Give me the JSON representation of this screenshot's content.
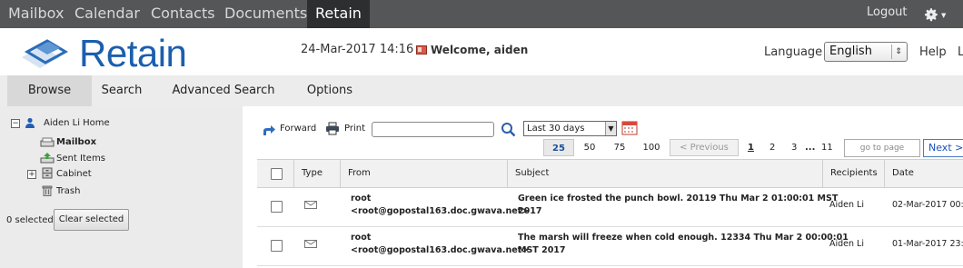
{
  "topbar": {
    "apps": [
      "Mailbox",
      "Calendar",
      "Contacts",
      "Documents",
      "Retain"
    ],
    "active_app": "Retain",
    "logout_label": "Logout"
  },
  "header": {
    "logo_text": "Retain",
    "datetime": "24-Mar-2017 14:16",
    "welcome": "Welcome, aiden",
    "language_label": "Language",
    "language_value": "English",
    "help_label": "Help",
    "cut_link": "L"
  },
  "tabs": [
    {
      "label": "Browse",
      "active": true
    },
    {
      "label": "Search",
      "active": false
    },
    {
      "label": "Advanced Search",
      "active": false
    },
    {
      "label": "Options",
      "active": false
    }
  ],
  "sidebar": {
    "root_label": "Aiden Li Home",
    "folders": [
      "Mailbox",
      "Sent Items",
      "Cabinet",
      "Trash"
    ],
    "selected_count": "0 selected",
    "clear_label": "Clear selected"
  },
  "toolbar": {
    "forward_label": "Forward",
    "print_label": "Print",
    "search_value": "",
    "period_value": "Last 30 days"
  },
  "pagination": {
    "page_sizes": [
      "25",
      "50",
      "75",
      "100"
    ],
    "active_size": "25",
    "prev_label": "< Previous",
    "pages": [
      "1",
      "2",
      "3",
      "...",
      "11"
    ],
    "current_page": "1",
    "goto_placeholder": "go to page",
    "next_label": "Next >"
  },
  "table": {
    "headers": [
      "Type",
      "From",
      "Subject",
      "Recipients",
      "Date"
    ],
    "rows": [
      {
        "from_name": "root",
        "from_email": "<root@gopostal163.doc.gwava.net>",
        "subject_line1": "Green ice frosted the punch bowl. 20119 Thu Mar 2 01:00:01 MST",
        "subject_line2": "2017",
        "recipients": "Aiden Li",
        "date": "02-Mar-2017 00:"
      },
      {
        "from_name": "root",
        "from_email": "<root@gopostal163.doc.gwava.net>",
        "subject_line1": "The marsh will freeze when cold enough. 12334 Thu Mar 2 00:00:01",
        "subject_line2": "MST 2017",
        "recipients": "Aiden Li",
        "date": "01-Mar-2017 23:"
      }
    ]
  },
  "colors": {
    "brand_blue": "#1a5fae",
    "topbar_bg": "#555657",
    "active_app_bg": "#2d2e2f",
    "sidebar_bg": "#ebebeb",
    "tabbar_bg": "#ececec",
    "link_blue": "#1a4fb8"
  }
}
